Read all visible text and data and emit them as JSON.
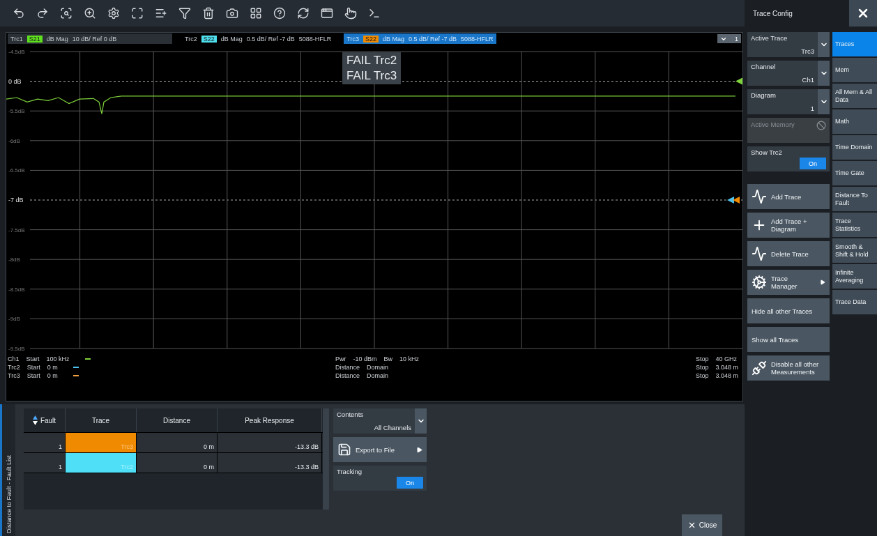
{
  "panel_title": "Trace Config",
  "trace_header": [
    {
      "name": "Trc1",
      "param": "S21",
      "color": "#5ee01e",
      "format": "dB Mag",
      "scale": "10 dB/ Ref 0 dB",
      "selected": false
    },
    {
      "name": "Trc2",
      "param": "S22",
      "color": "#4fe0f0",
      "format": "dB Mag",
      "scale": "0.5 dB/ Ref -7 dB",
      "extra": "5088-HFLR",
      "selected": false
    },
    {
      "name": "Trc3",
      "param": "S22",
      "color": "#f08a00",
      "format": "dB Mag",
      "scale": "0.5 dB/ Ref -7 dB",
      "extra": "5088-HFLR",
      "selected": true
    }
  ],
  "diagram_number": "1",
  "failures": [
    "FAIL Trc2",
    "FAIL Trc3"
  ],
  "grid_labels": [
    {
      "text": "-4.5dB",
      "kind": "normal"
    },
    {
      "text": "0 dB",
      "kind": "ref"
    },
    {
      "text": "-5.5dB",
      "kind": "normal"
    },
    {
      "text": "-6dB",
      "kind": "normal"
    },
    {
      "text": "-6.5dB",
      "kind": "normal"
    },
    {
      "text": "-7 dB",
      "kind": "ref"
    },
    {
      "text": "-7.5dB",
      "kind": "normal"
    },
    {
      "text": "-8dB",
      "kind": "normal"
    },
    {
      "text": "-8.5dB",
      "kind": "normal"
    },
    {
      "text": "-9dB",
      "kind": "normal"
    },
    {
      "text": "-9.5dB",
      "kind": "normal"
    }
  ],
  "info_rows": [
    {
      "channel": "Ch1",
      "start_label": "Start",
      "start": "100 kHz",
      "color": "#7fd23a",
      "middle": [
        "Pwr",
        "-10 dBm",
        "Bw",
        "10 kHz"
      ],
      "stop_label": "Stop",
      "stop": "40 GHz"
    },
    {
      "channel": "Trc2",
      "start_label": "Start",
      "start": "0 m",
      "color": "#4fc3f0",
      "middle": [
        "Distance",
        "Domain"
      ],
      "stop_label": "Stop",
      "stop": "3.048 m"
    },
    {
      "channel": "Trc3",
      "start_label": "Start",
      "start": "0 m",
      "color": "#f0a040",
      "middle": [
        "Distance",
        "Domain"
      ],
      "stop_label": "Stop",
      "stop": "3.048 m"
    }
  ],
  "fault_list": {
    "tab_label": "Distance to Fault - Fault List",
    "columns": [
      "Fault",
      "Trace",
      "Distance",
      "Peak Response"
    ],
    "rows": [
      {
        "fault": "1",
        "trace": "Trc3",
        "color": "#f08a00",
        "distance": "0 m",
        "peak": "-13.3 dB"
      },
      {
        "fault": "1",
        "trace": "Trc2",
        "color": "#4fe0f8",
        "distance": "0 m",
        "peak": "-13.3 dB"
      }
    ],
    "contents": {
      "label": "Contents",
      "value": "All Channels"
    },
    "export": "Export to File",
    "tracking": {
      "label": "Tracking",
      "state": "On",
      "on": true
    }
  },
  "close": "Close",
  "controls": [
    {
      "kind": "dropdown",
      "label": "Active Trace",
      "value": "Trc3"
    },
    {
      "kind": "dropdown",
      "label": "Channel",
      "value": "Ch1"
    },
    {
      "kind": "dropdown",
      "label": "Diagram",
      "value": "1"
    },
    {
      "kind": "disabled",
      "label": "Active Memory"
    },
    {
      "kind": "toggle",
      "label": "Show Trc2",
      "state": "On",
      "on": true
    },
    {
      "kind": "icon_button",
      "label": "Add Trace"
    },
    {
      "kind": "icon_button",
      "label": "Add Trace + Diagram"
    },
    {
      "kind": "icon_button",
      "label": "Delete Trace"
    },
    {
      "kind": "menu_button",
      "label": "Trace Manager"
    },
    {
      "kind": "text_button",
      "label": "Hide all other Traces"
    },
    {
      "kind": "text_button",
      "label": "Show all Traces"
    },
    {
      "kind": "icon_button",
      "label": "Disable all other Measurements"
    }
  ],
  "softkeys": [
    {
      "label": "Traces",
      "selected": true
    },
    {
      "label": "Mem",
      "selected": false
    },
    {
      "label": "All Mem & All Data",
      "selected": false
    },
    {
      "label": "Math",
      "selected": false
    },
    {
      "label": "Time Domain",
      "selected": false
    },
    {
      "label": "Time Gate",
      "selected": false
    },
    {
      "label": "Distance To Fault",
      "selected": false
    },
    {
      "label": "Trace Statistics",
      "selected": false
    },
    {
      "label": "Smooth & Shift & Hold",
      "selected": false
    },
    {
      "label": "Infinite Averaging",
      "selected": false
    },
    {
      "label": "Trace Data",
      "selected": false
    }
  ]
}
